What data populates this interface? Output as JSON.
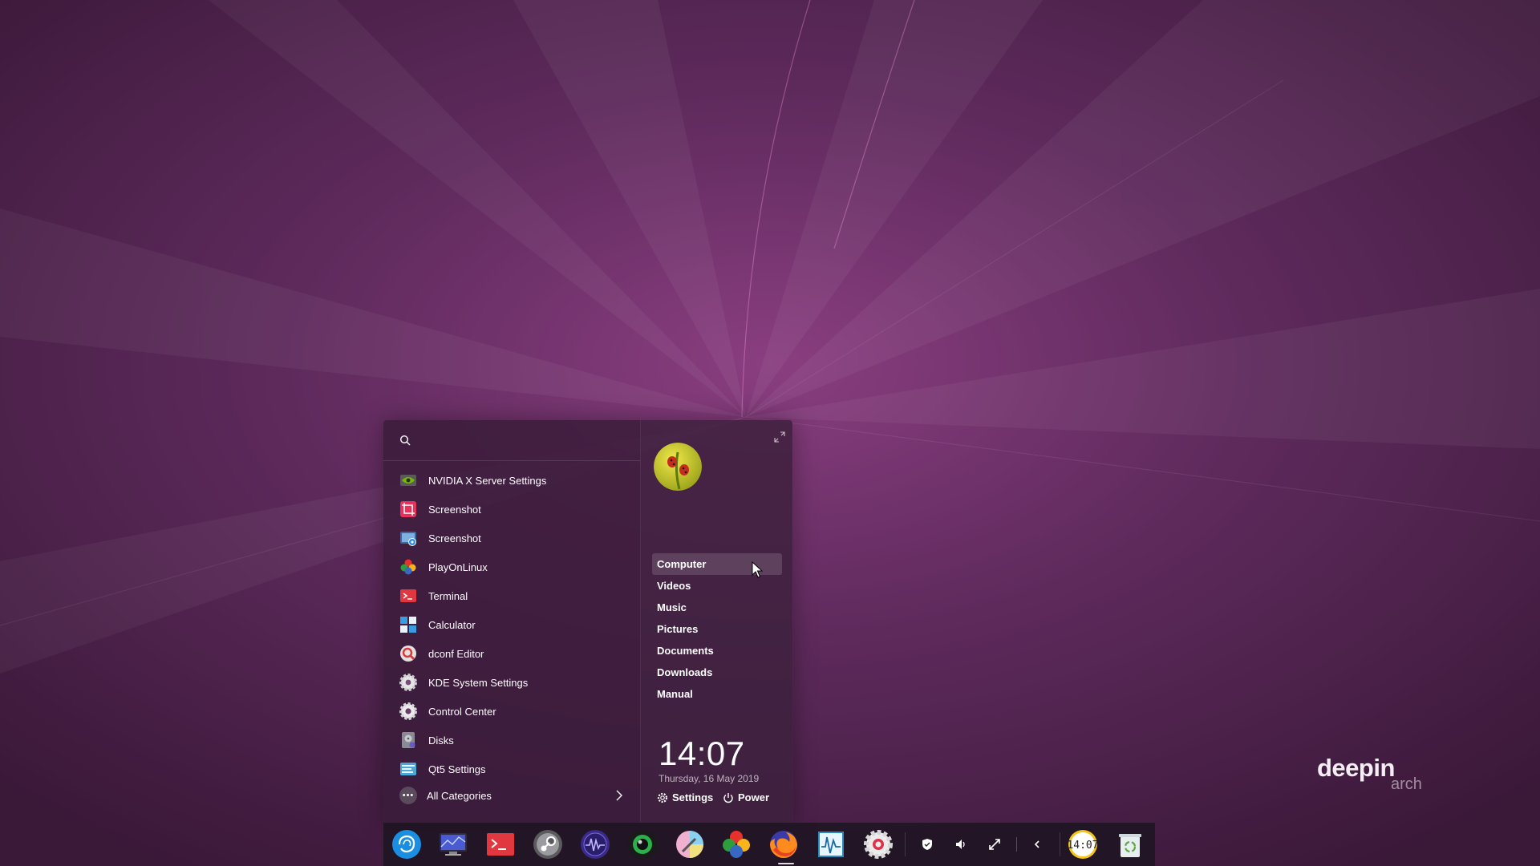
{
  "colors": {
    "wallpaper_base": "#4a2247",
    "wallpaper_glow": "#8a3e80",
    "launcher_bg": "#3a1c3a",
    "dock_bg": "#1e1422",
    "text": "#ffffff"
  },
  "launcher": {
    "search": {
      "icon": "search-icon",
      "placeholder": ""
    },
    "apps": [
      {
        "label": "NVIDIA X Server Settings",
        "icon": "nvidia-icon"
      },
      {
        "label": "Screenshot",
        "icon": "deepin-screenshot-icon"
      },
      {
        "label": "Screenshot",
        "icon": "gnome-screenshot-icon"
      },
      {
        "label": "PlayOnLinux",
        "icon": "playonlinux-icon"
      },
      {
        "label": "Terminal",
        "icon": "terminal-icon"
      },
      {
        "label": "Calculator",
        "icon": "calculator-icon"
      },
      {
        "label": "dconf Editor",
        "icon": "dconf-editor-icon"
      },
      {
        "label": "KDE System Settings",
        "icon": "kde-settings-icon"
      },
      {
        "label": "Control Center",
        "icon": "control-center-icon"
      },
      {
        "label": "Disks",
        "icon": "disks-icon"
      },
      {
        "label": "Qt5 Settings",
        "icon": "qt5-settings-icon"
      }
    ],
    "all_categories": {
      "label": "All Categories",
      "icon": "more-dots-icon"
    },
    "places": [
      {
        "label": "Computer",
        "active": true
      },
      {
        "label": "Videos"
      },
      {
        "label": "Music"
      },
      {
        "label": "Pictures"
      },
      {
        "label": "Documents"
      },
      {
        "label": "Downloads"
      },
      {
        "label": "Manual"
      }
    ],
    "clock": {
      "time": "14:07",
      "date": "Thursday, 16 May 2019"
    },
    "settings_label": "Settings",
    "power_label": "Power"
  },
  "logo": {
    "brand": "deepin",
    "sub": "arch"
  },
  "dock": {
    "apps": [
      "deepin-launcher-icon",
      "system-monitor-desktop-icon",
      "terminal-icon",
      "steam-icon",
      "cpu-monitor-icon",
      "green-eye-icon",
      "color-picker-icon",
      "playonlinux-icon",
      "firefox-icon",
      "activity-monitor-icon",
      "control-center-icon"
    ],
    "tray": [
      "shield-icon",
      "volume-icon",
      "network-icon",
      "chevron-left-icon"
    ],
    "tray_clock": "14:07",
    "trash": "trash-icon"
  }
}
